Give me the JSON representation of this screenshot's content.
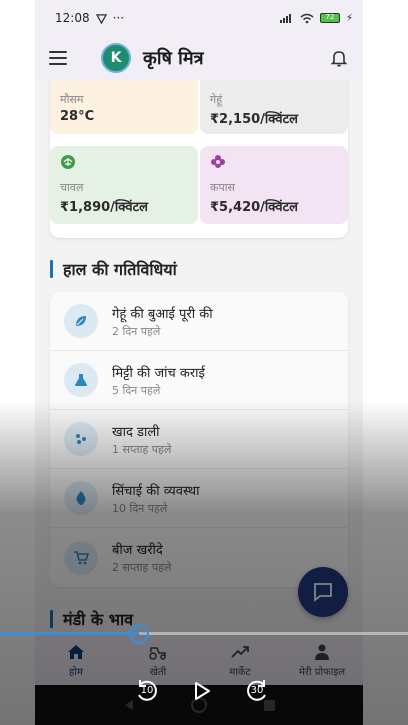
{
  "status": {
    "time": "12:08",
    "battery": "72"
  },
  "app": {
    "title": "कृषि मित्र",
    "avatar_letter": "K"
  },
  "tiles": [
    {
      "label": "मौसम",
      "value": "28°C",
      "bg": "#fdf2e2"
    },
    {
      "label": "गेहूं",
      "value": "₹2,150/क्विंटल",
      "bg": "#ececec"
    },
    {
      "label": "चावल",
      "value": "₹1,890/क्विंटल",
      "bg": "#e6f1e6"
    },
    {
      "label": "कपास",
      "value": "₹5,420/क्विंटल",
      "bg": "#f3e4f3"
    }
  ],
  "sections": {
    "recent_activities": "हाल की गतिविधियां",
    "mandi_prices": "मंडी के भाव"
  },
  "activities": [
    {
      "title": "गेहूं की बुआई पूरी की",
      "time": "2 दिन पहले",
      "icon": "leaf-icon"
    },
    {
      "title": "मिट्टी की जांच कराई",
      "time": "5 दिन पहले",
      "icon": "flask-icon"
    },
    {
      "title": "खाद डाली",
      "time": "1 सप्ताह पहले",
      "icon": "fertilizer-icon"
    },
    {
      "title": "सिंचाई की व्यवस्था",
      "time": "10 दिन पहले",
      "icon": "water-drop-icon"
    },
    {
      "title": "बीज खरीदे",
      "time": "2 सप्ताह पहले",
      "icon": "cart-icon"
    }
  ],
  "bottom_nav": [
    {
      "label": "होम",
      "icon": "home-icon",
      "active": true
    },
    {
      "label": "खेती",
      "icon": "tractor-icon",
      "active": false
    },
    {
      "label": "मार्केट",
      "icon": "trend-icon",
      "active": false
    },
    {
      "label": "मेरी प्रोफाइल",
      "icon": "person-icon",
      "active": false
    }
  ],
  "player": {
    "rewind_seconds": "10",
    "forward_seconds": "30",
    "progress": 0.34
  },
  "colors": {
    "accent": "#1e6fb0",
    "fab": "#213a82",
    "seek": "#3a8fd6"
  }
}
